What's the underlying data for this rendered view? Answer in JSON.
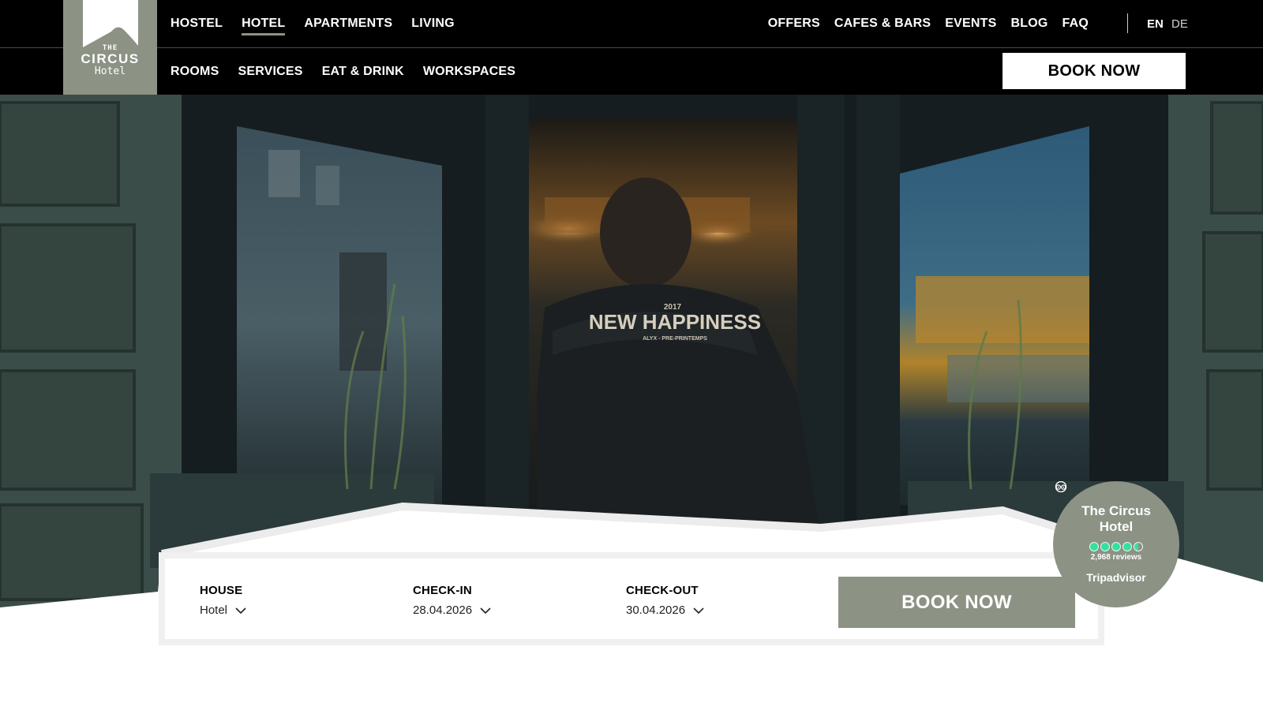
{
  "brand": {
    "logo_the": "THE",
    "logo_circus": "CIRCUS",
    "logo_hotel": "Hotel"
  },
  "nav_top_left": [
    {
      "label": "HOSTEL",
      "active": false
    },
    {
      "label": "HOTEL",
      "active": true
    },
    {
      "label": "APARTMENTS",
      "active": false
    },
    {
      "label": "LIVING",
      "active": false
    }
  ],
  "nav_top_right": [
    {
      "label": "OFFERS"
    },
    {
      "label": "CAFES & BARS"
    },
    {
      "label": "EVENTS"
    },
    {
      "label": "BLOG"
    },
    {
      "label": "FAQ"
    }
  ],
  "languages": {
    "en": "EN",
    "de": "DE",
    "active": "EN"
  },
  "nav_bottom": [
    {
      "label": "ROOMS"
    },
    {
      "label": "SERVICES"
    },
    {
      "label": "EAT & DRINK"
    },
    {
      "label": "WORKSPACES"
    }
  ],
  "header_cta": "BOOK NOW",
  "hero": {
    "jacket_line1": "2017",
    "jacket_line2": "NEW HAPPINESS",
    "jacket_line3": "ALYX - PRE-PRINTEMPS"
  },
  "tripadvisor": {
    "name": "The Circus Hotel",
    "rating": 4.5,
    "reviews": "2,968 reviews",
    "brand": "Tripadvisor",
    "dot_color": "#34e0a1"
  },
  "booking": {
    "house": {
      "label": "HOUSE",
      "value": "Hotel"
    },
    "checkin": {
      "label": "CHECK-IN",
      "value": "28.04.2026"
    },
    "checkout": {
      "label": "CHECK-OUT",
      "value": "30.04.2026"
    },
    "cta": "BOOK NOW"
  },
  "colors": {
    "header_bg": "#000000",
    "accent": "#8c9284",
    "text_light": "#ffffff"
  }
}
